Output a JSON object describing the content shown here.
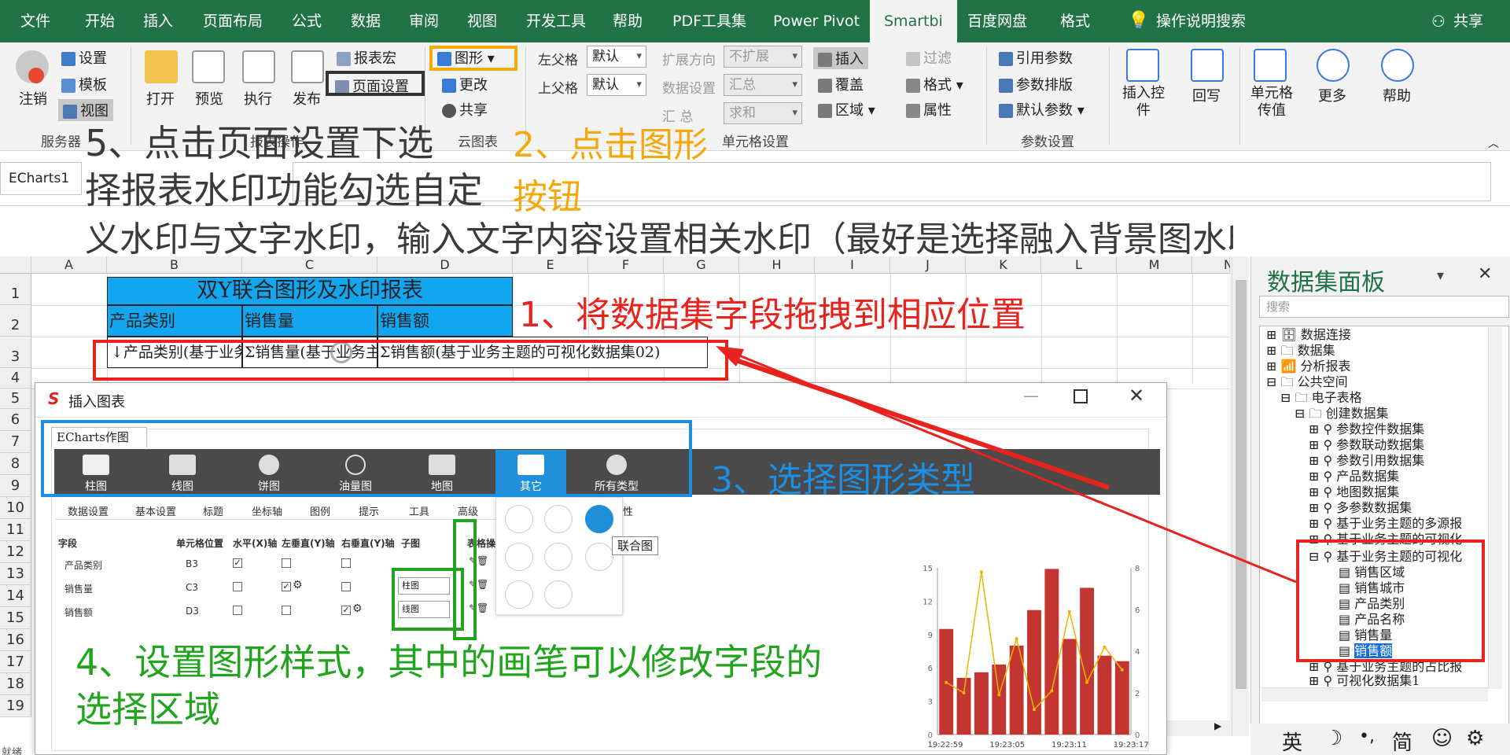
{
  "tabs": [
    "文件",
    "开始",
    "插入",
    "页面布局",
    "公式",
    "数据",
    "审阅",
    "视图",
    "开发工具",
    "帮助",
    "PDF工具集",
    "Power Pivot",
    "Smartbi",
    "百度网盘",
    "格式"
  ],
  "tab_search": "操作说明搜索",
  "tab_share": "共享",
  "ribbon": {
    "logout": "注销",
    "settings": "设置",
    "template": "模板",
    "view": "视图",
    "group_server": "服务器",
    "open": "打开",
    "preview": "预览",
    "execute": "执行",
    "publish": "发布",
    "report_macro": "报表宏",
    "page_setup": "页面设置",
    "group_report_ops": "报表操作",
    "chart": "图形",
    "change": "更改",
    "share": "共享",
    "group_cloud": "云图表",
    "left_parent": "左父格",
    "left_parent_val": "默认",
    "top_parent": "上父格",
    "top_parent_val": "默认",
    "expand_dir": "扩展方向",
    "expand_val": "不扩展",
    "data_setting": "数据设置",
    "data_val": "汇总",
    "summary": "汇  总",
    "summary_val": "求和",
    "group_cell": "单元格设置",
    "insert": "插入",
    "cover": "覆盖",
    "region": "区域",
    "filter": "过滤",
    "format": "格式",
    "property": "属性",
    "ref_param": "引用参数",
    "param_layout": "参数排版",
    "default_param": "默认参数",
    "group_param": "参数设置",
    "insert_ctrl": "插入控件",
    "writeback": "回写",
    "cell_pass": "单元格传值",
    "more": "更多",
    "help": "帮助"
  },
  "namebox": "ECharts1",
  "columns": [
    "A",
    "B",
    "C",
    "D",
    "E",
    "F",
    "G",
    "H",
    "I",
    "J",
    "K",
    "L",
    "M",
    "N"
  ],
  "rows": [
    "1",
    "2",
    "3",
    "4",
    "5",
    "6",
    "7",
    "8",
    "9",
    "10",
    "11",
    "12",
    "13",
    "14",
    "15",
    "16",
    "17",
    "18",
    "19"
  ],
  "cells": {
    "title": "双Y联合图形及水印报表",
    "h1": "产品类别",
    "h2": "销售量",
    "h3": "销售额",
    "f1": "↓产品类别(基于业务主题的可视化数据集02)",
    "f2": "Σ销售量(基于业务主题的可视化数据集02)",
    "f3": "Σ销售额(基于业务主题的可视化数据集02)"
  },
  "dialog": {
    "title": "插入图表",
    "echarts_tab": "ECharts作图",
    "types": [
      "柱图",
      "线图",
      "饼图",
      "油量图",
      "地图",
      "其它",
      "所有类型"
    ],
    "sub_tabs": [
      "数据设置",
      "基本设置",
      "标题",
      "坐标轴",
      "图例",
      "提示",
      "工具",
      "高级"
    ],
    "col_field": "字段",
    "col_pos": "单元格位置",
    "col_x": "水平(X)轴",
    "col_ly": "左垂直(Y)轴",
    "col_ry": "右垂直(Y)轴",
    "col_sub": "子图",
    "col_op": "表格操",
    "fields": [
      {
        "name": "产品类别",
        "pos": "B3",
        "sub": ""
      },
      {
        "name": "销售量",
        "pos": "C3",
        "sub": "柱图"
      },
      {
        "name": "销售额",
        "pos": "D3",
        "sub": "线图"
      }
    ],
    "popup_tooltip": "联合图",
    "popup_partial": "性"
  },
  "chart_data": {
    "type": "bar",
    "categories": [
      "19:22:59",
      "19:23:05",
      "19:23:11",
      "19:23:17"
    ],
    "bar_values": [
      9.5,
      5.1,
      5.6,
      6.3,
      8.0,
      11.2,
      14.9,
      8.6,
      13.2,
      7.1,
      6.6
    ],
    "line_values": [
      2.5,
      2.0,
      7.8,
      1.9,
      4.6,
      1.2,
      2.1,
      5.9,
      2.5,
      4.2,
      3.1
    ],
    "left_ticks": [
      "15",
      "12",
      "9",
      "6",
      "3",
      "0"
    ],
    "right_ticks": [
      "8",
      "6",
      "4",
      "2",
      "0"
    ],
    "ylim_left": [
      0,
      15
    ],
    "ylim_right": [
      0,
      8
    ],
    "bar_color": "#c23531",
    "line_color": "#f0b400"
  },
  "panel": {
    "title": "数据集面板",
    "search": "搜索",
    "tree": [
      "数据连接",
      "数据集",
      "分析报表",
      "公共空间",
      "电子表格",
      "创建数据集",
      "参数控件数据集",
      "参数联动数据集",
      "参数引用数据集",
      "产品数据集",
      "地图数据集",
      "多参数数据集",
      "基于业务主题的多源报",
      "基于业务主题的可视化",
      "基于业务主题的可视化",
      "销售区域",
      "销售城市",
      "产品类别",
      "产品名称",
      "销售量",
      "销售额",
      "基于业务主题的占比报",
      "可视化数据集1"
    ]
  },
  "status": {
    "ready": "就绪",
    "ime": [
      "英",
      "☽",
      "•,",
      "简",
      "☺",
      "⚙"
    ]
  },
  "annotations": {
    "a1": "1、将数据集字段拖拽到相应位置",
    "a2_1": "2、点击图形",
    "a2_2": "按钮",
    "a3": "3、选择图形类型",
    "a4_1": "4、设置图形样式，其中的画笔可以修改字段的",
    "a4_2": "选择区域",
    "a5_1": "5、点击页面设置下选",
    "a5_2": "择报表水印功能勾选自定",
    "a5_3": "义水印与文字水印，输入文字内容设置相关水印（最好是选择融入背景图水印模式）"
  },
  "colors": {
    "excel_green": "#217346",
    "echarts_active": "#1e8fd8",
    "red": "#e8221c",
    "orange": "#f5a80a",
    "blue": "#1a8fe3",
    "green": "#22a51e"
  }
}
